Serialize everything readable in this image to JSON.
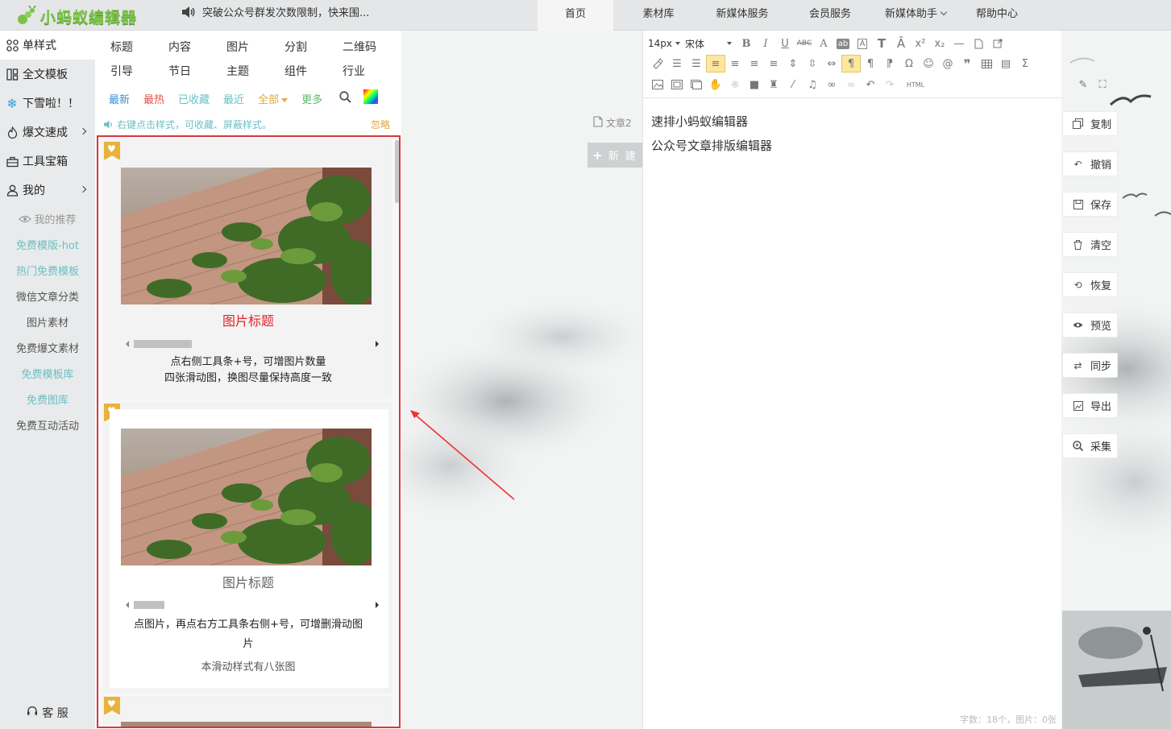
{
  "app": {
    "logo_text": "小蚂蚁编辑器",
    "notice": "突破公众号群发次数限制，快来围..."
  },
  "nav": [
    {
      "label": "首页",
      "active": true
    },
    {
      "label": "素材库"
    },
    {
      "label": "新媒体服务"
    },
    {
      "label": "会员服务"
    },
    {
      "label": "新媒体助手"
    },
    {
      "label": "帮助中心"
    }
  ],
  "sidebar": {
    "items": [
      {
        "label": "单样式",
        "icon": "grid-icon"
      },
      {
        "label": "全文模板",
        "icon": "template-icon"
      },
      {
        "label": "下雪啦！！",
        "icon": "snowflake-icon"
      },
      {
        "label": "爆文速成",
        "icon": "fire-icon"
      },
      {
        "label": "工具宝箱",
        "icon": "toolbox-icon"
      },
      {
        "label": "我的",
        "icon": "user-icon"
      }
    ],
    "sub_items": [
      {
        "label": "我的推荐",
        "style": "gray"
      },
      {
        "label": "免费模版-hot",
        "style": "teal"
      },
      {
        "label": "热门免费模板",
        "style": "teal"
      },
      {
        "label": "微信文章分类",
        "style": "dark"
      },
      {
        "label": "图片素材",
        "style": "dark"
      },
      {
        "label": "免费爆文素材",
        "style": "dark"
      },
      {
        "label": "免费模板库",
        "style": "teal"
      },
      {
        "label": "免费图库",
        "style": "teal"
      },
      {
        "label": "免费互动活动",
        "style": "dark"
      }
    ],
    "service": "客 服"
  },
  "panel": {
    "categories_row1": [
      "标题",
      "内容",
      "图片",
      "分割",
      "二维码"
    ],
    "categories_row2": [
      "引导",
      "节日",
      "主题",
      "组件",
      "行业"
    ],
    "filters": [
      {
        "label": "最新",
        "color": "#3b8fd8"
      },
      {
        "label": "最热",
        "color": "#e2524a"
      },
      {
        "label": "已收藏",
        "color": "#6bbfc4"
      },
      {
        "label": "最近",
        "color": "#6bbfc4"
      },
      {
        "label": "全部",
        "color": "#e8a43a"
      },
      {
        "label": "更多",
        "color": "#5cba6a"
      }
    ],
    "tip": "右键点击样式，可收藏、屏蔽样式。",
    "ignore": "忽略",
    "cards": [
      {
        "title": "图片标题",
        "title_color": "#e0252b",
        "text1": "点右侧工具条+号，可增图片数量",
        "text2": "四张滑动图，换图尽量保持高度一致"
      },
      {
        "title": "图片标题",
        "title_color": "#666666",
        "text1": "点图片，再点右方工具条右侧+号，可增删滑动图",
        "text1b": "片",
        "text2": "本滑动样式有八张图"
      }
    ]
  },
  "doc": {
    "tab": "文章2",
    "new": "新 建"
  },
  "editor": {
    "font_size": "14px",
    "font_family": "宋体",
    "lines": [
      "速排小蚂蚁编辑器",
      "公众号文章排版编辑器"
    ],
    "status": "字数：18个，图片：0张",
    "html_label": "HTML"
  },
  "actions": [
    {
      "label": "复制",
      "icon": "copy-icon"
    },
    {
      "label": "撤销",
      "icon": "undo-icon"
    },
    {
      "label": "保存",
      "icon": "save-icon"
    },
    {
      "label": "清空",
      "icon": "trash-icon"
    },
    {
      "label": "恢复",
      "icon": "restore-icon"
    },
    {
      "label": "预览",
      "icon": "eye-icon"
    },
    {
      "label": "同步",
      "icon": "sync-icon"
    },
    {
      "label": "导出",
      "icon": "export-icon"
    },
    {
      "label": "采集",
      "icon": "collect-icon"
    }
  ],
  "colors": {
    "accent": "#6bbfc4",
    "highlight_border": "#d9363e",
    "logo_green": "#7cc24a"
  }
}
